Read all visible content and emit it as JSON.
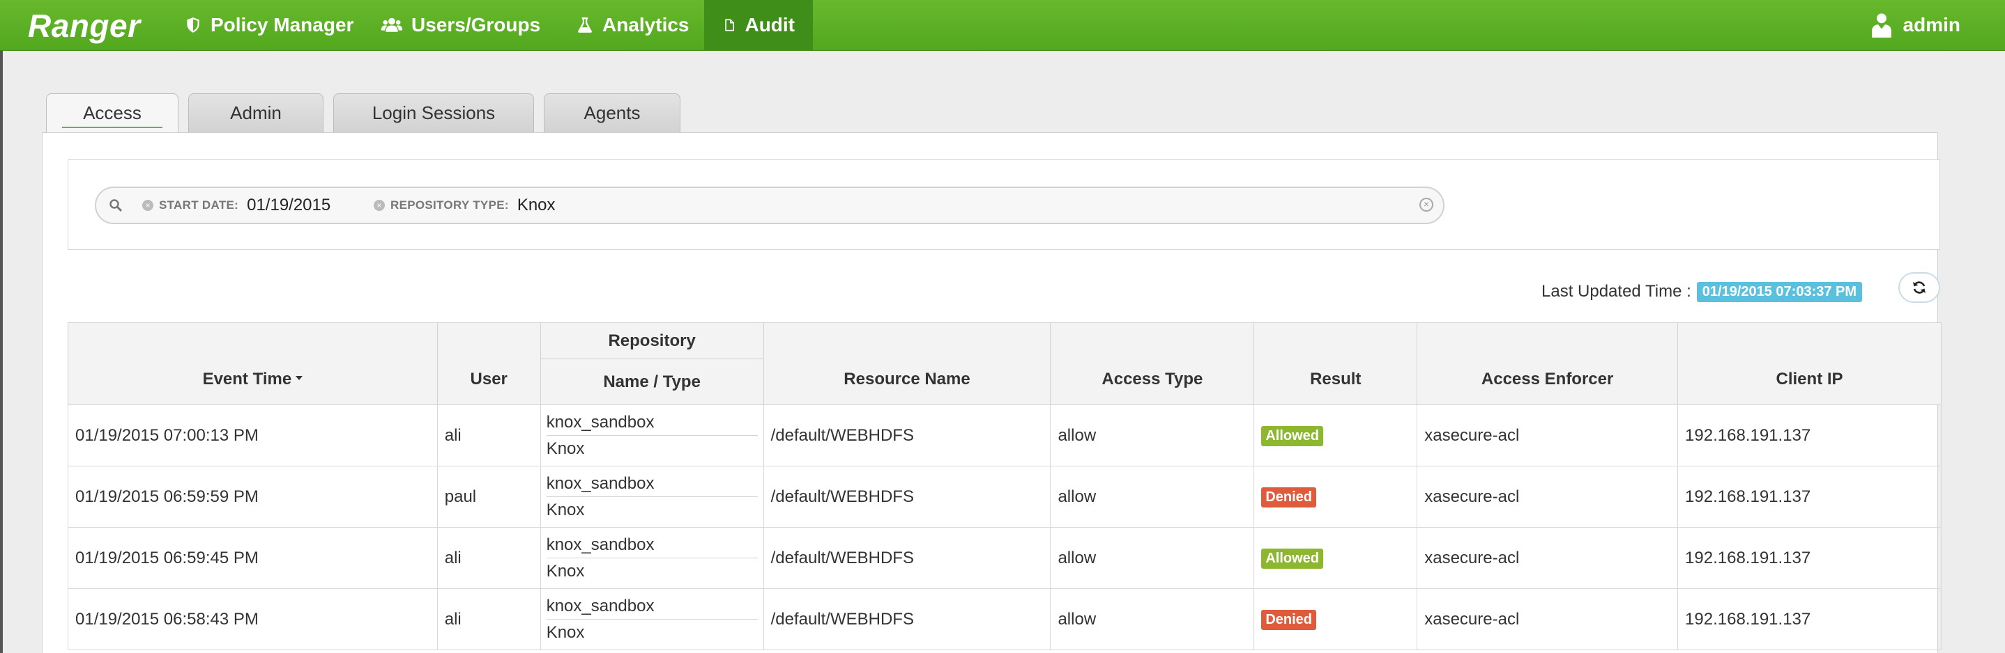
{
  "navbar": {
    "brand": "Ranger",
    "items": [
      {
        "label": "Policy Manager",
        "icon": "shield-icon"
      },
      {
        "label": "Users/Groups",
        "icon": "users-icon"
      },
      {
        "label": "Analytics",
        "icon": "flask-icon"
      },
      {
        "label": "Audit",
        "icon": "file-icon",
        "active": true
      }
    ],
    "user": "admin"
  },
  "tabs": [
    "Access",
    "Admin",
    "Login Sessions",
    "Agents"
  ],
  "search": {
    "facets": [
      {
        "label": "START DATE:",
        "value": "01/19/2015"
      },
      {
        "label": "REPOSITORY TYPE:",
        "value": "Knox"
      }
    ]
  },
  "last_updated": {
    "label": "Last Updated Time :",
    "value": "01/19/2015 07:03:37 PM"
  },
  "table": {
    "group_header": "Repository",
    "columns": [
      "Event Time",
      "User",
      "Name / Type",
      "Resource Name",
      "Access Type",
      "Result",
      "Access Enforcer",
      "Client IP"
    ],
    "rows": [
      {
        "time": "01/19/2015 07:00:13 PM",
        "user": "ali",
        "repo": "knox_sandbox",
        "type": "Knox",
        "resource": "/default/WEBHDFS",
        "access": "allow",
        "result": "Allowed",
        "enforcer": "xasecure-acl",
        "ip": "192.168.191.137"
      },
      {
        "time": "01/19/2015 06:59:59 PM",
        "user": "paul",
        "repo": "knox_sandbox",
        "type": "Knox",
        "resource": "/default/WEBHDFS",
        "access": "allow",
        "result": "Denied",
        "enforcer": "xasecure-acl",
        "ip": "192.168.191.137"
      },
      {
        "time": "01/19/2015 06:59:45 PM",
        "user": "ali",
        "repo": "knox_sandbox",
        "type": "Knox",
        "resource": "/default/WEBHDFS",
        "access": "allow",
        "result": "Allowed",
        "enforcer": "xasecure-acl",
        "ip": "192.168.191.137"
      },
      {
        "time": "01/19/2015 06:58:43 PM",
        "user": "ali",
        "repo": "knox_sandbox",
        "type": "Knox",
        "resource": "/default/WEBHDFS",
        "access": "allow",
        "result": "Denied",
        "enforcer": "xasecure-acl",
        "ip": "192.168.191.137"
      }
    ]
  },
  "colors": {
    "navbar": "#5fb226",
    "allowed": "#8cb72e",
    "denied": "#e05a3c",
    "timestamp": "#5bc0de"
  }
}
